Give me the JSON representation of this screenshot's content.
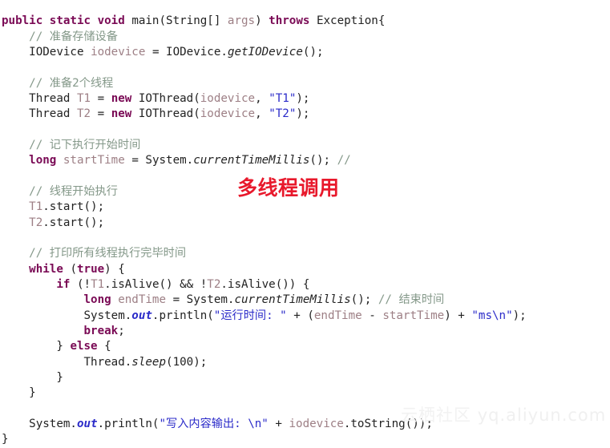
{
  "editor": {
    "language": "Java",
    "background_color": "#ffffff",
    "default_text_color": "#222222",
    "keyword_color": "#7a0a55",
    "comment_color": "#85998a",
    "string_color": "#2b2bc9",
    "identifier_color": "#9d7f85",
    "font_size_px": 14
  },
  "code_lines": [
    {
      "n": 1,
      "text": "public static void main(String[] args) throws Exception{"
    },
    {
      "n": 2,
      "text": "    // 准备存储设备"
    },
    {
      "n": 3,
      "text": "    IODevice iodevice = IODevice.getIODevice();"
    },
    {
      "n": 4,
      "text": ""
    },
    {
      "n": 5,
      "text": "    // 准备2个线程"
    },
    {
      "n": 6,
      "text": "    Thread T1 = new IOThread(iodevice, \"T1\");"
    },
    {
      "n": 7,
      "text": "    Thread T2 = new IOThread(iodevice, \"T2\");"
    },
    {
      "n": 8,
      "text": ""
    },
    {
      "n": 9,
      "text": "    // 记下执行开始时间"
    },
    {
      "n": 10,
      "text": "    long startTime = System.currentTimeMillis(); //"
    },
    {
      "n": 11,
      "text": ""
    },
    {
      "n": 12,
      "text": "    // 线程开始执行"
    },
    {
      "n": 13,
      "text": "    T1.start();"
    },
    {
      "n": 14,
      "text": "    T2.start();"
    },
    {
      "n": 15,
      "text": ""
    },
    {
      "n": 16,
      "text": "    // 打印所有线程执行完毕时间"
    },
    {
      "n": 17,
      "text": "    while (true) {"
    },
    {
      "n": 18,
      "text": "        if (!T1.isAlive() && !T2.isAlive()) {"
    },
    {
      "n": 19,
      "text": "            long endTime = System.currentTimeMillis(); // 结束时间"
    },
    {
      "n": 20,
      "text": "            System.out.println(\"运行时间: \" + (endTime - startTime) + \"ms\\n\");"
    },
    {
      "n": 21,
      "text": "            break;"
    },
    {
      "n": 22,
      "text": "        } else {"
    },
    {
      "n": 23,
      "text": "            Thread.sleep(100);"
    },
    {
      "n": 24,
      "text": "        }"
    },
    {
      "n": 25,
      "text": "    }"
    },
    {
      "n": 26,
      "text": ""
    },
    {
      "n": 27,
      "text": "    System.out.println(\"写入内容输出: \\n\" + iodevice.toString());"
    },
    {
      "n": 28,
      "text": "}"
    }
  ],
  "annotation": {
    "text": "多线程调用",
    "color": "#e8192c"
  },
  "watermark": {
    "cn_text": "云栖社区",
    "en_text": "yq.aliyun.com",
    "color": "#f0f0f0"
  }
}
